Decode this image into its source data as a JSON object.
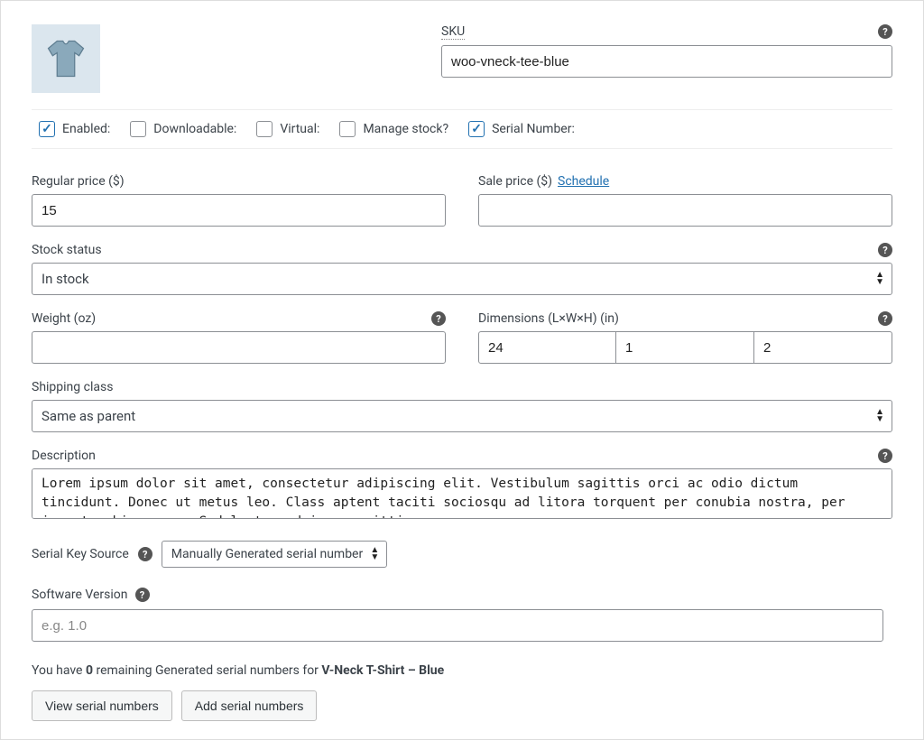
{
  "sku": {
    "label": "SKU",
    "value": "woo-vneck-tee-blue"
  },
  "checkboxes": {
    "enabled": {
      "label": "Enabled:",
      "checked": true
    },
    "download": {
      "label": "Downloadable:",
      "checked": false
    },
    "virtual": {
      "label": "Virtual:",
      "checked": false
    },
    "stock": {
      "label": "Manage stock?",
      "checked": false
    },
    "serial": {
      "label": "Serial Number:",
      "checked": true
    }
  },
  "price": {
    "regular": {
      "label": "Regular price ($)",
      "value": "15"
    },
    "sale": {
      "label": "Sale price ($)",
      "schedule": "Schedule",
      "value": ""
    }
  },
  "stock_status": {
    "label": "Stock status",
    "value": "In stock"
  },
  "weight": {
    "label": "Weight (oz)",
    "value": ""
  },
  "dimensions": {
    "label": "Dimensions (L×W×H) (in)",
    "l": "24",
    "w": "1",
    "h": "2"
  },
  "shipping_class": {
    "label": "Shipping class",
    "value": "Same as parent"
  },
  "description": {
    "label": "Description",
    "value": "Lorem ipsum dolor sit amet, consectetur adipiscing elit. Vestibulum sagittis orci ac odio dictum tincidunt. Donec ut metus leo. Class aptent taciti sociosqu ad litora torquent per conubia nostra, per inceptos himenaeos. Sed luctus, dui eu sagittis"
  },
  "serial_source": {
    "label": "Serial Key Source",
    "value": "Manually Generated serial number"
  },
  "software_version": {
    "label": "Software Version",
    "placeholder": "e.g. 1.0",
    "value": ""
  },
  "note": {
    "prefix": "You have ",
    "count": "0",
    "middle": " remaining Generated serial numbers for ",
    "product": "V-Neck T-Shirt – Blue"
  },
  "buttons": {
    "view": "View serial numbers",
    "add": "Add serial numbers"
  }
}
